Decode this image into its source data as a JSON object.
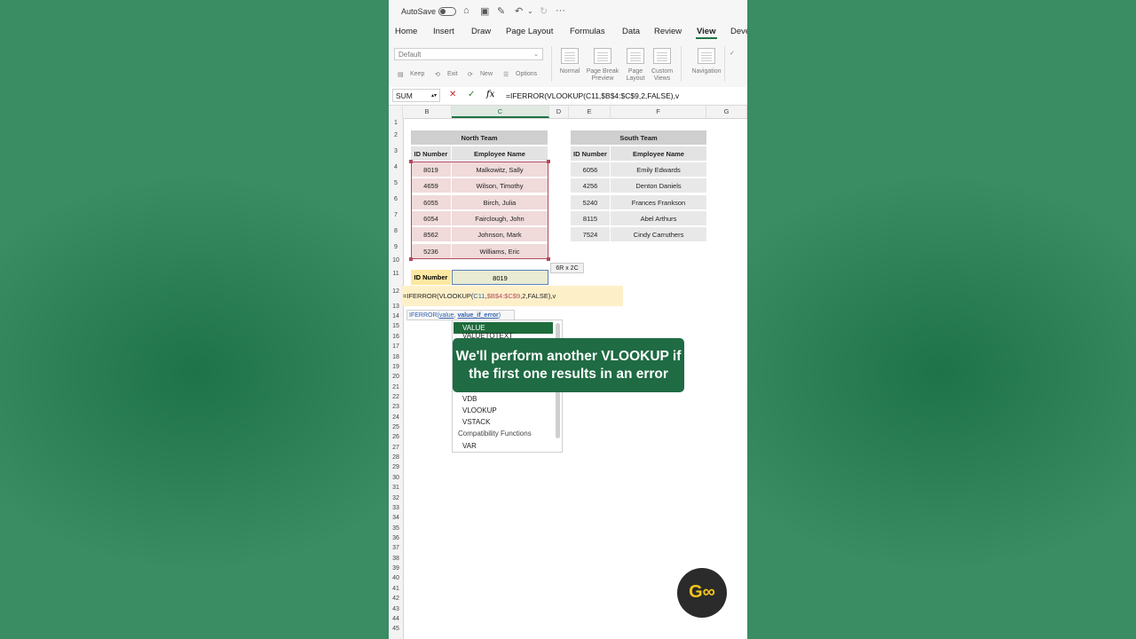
{
  "titlebar": {
    "autosave": "AutoSave",
    "more": "···"
  },
  "tabs": [
    "Home",
    "Insert",
    "Draw",
    "Page Layout",
    "Formulas",
    "Data",
    "Review",
    "View",
    "Deve"
  ],
  "ribbon": {
    "style_select": "Default",
    "keep": "Keep",
    "exit": "Exit",
    "new": "New",
    "options": "Options",
    "normal": "Normal",
    "page_break_preview": "Page Break\nPreview",
    "page_layout": "Page\nLayout",
    "custom_views": "Custom\nViews",
    "navigation": "Navigation"
  },
  "formula_bar": {
    "name_box": "SUM",
    "cancel": "✕",
    "enter": "✓",
    "fx": "fx",
    "formula": "=IFERROR(VLOOKUP(C11,$B$4:$C$9,2,FALSE),v"
  },
  "columns": [
    "B",
    "C",
    "D",
    "E",
    "F",
    "G"
  ],
  "rows": [
    "1",
    "2",
    "3",
    "4",
    "5",
    "6",
    "7",
    "8",
    "9",
    "10",
    "11",
    "12",
    "13",
    "14",
    "15",
    "16",
    "17",
    "18",
    "19",
    "20",
    "21",
    "22",
    "23",
    "24",
    "25",
    "26",
    "27",
    "28",
    "29",
    "30",
    "31",
    "32",
    "33",
    "34",
    "35",
    "36",
    "37",
    "38",
    "39",
    "40",
    "41",
    "42",
    "43",
    "44",
    "45"
  ],
  "north": {
    "title": "North Team",
    "headers": [
      "ID Number",
      "Employee Name"
    ],
    "rows": [
      [
        "8019",
        "Malkowitz, Sally"
      ],
      [
        "4659",
        "Wilson, Timothy"
      ],
      [
        "6055",
        "Birch, Julia"
      ],
      [
        "6054",
        "Fairclough, John"
      ],
      [
        "8562",
        "Johnson, Mark"
      ],
      [
        "5236",
        "Williams, Eric"
      ]
    ]
  },
  "south": {
    "title": "South Team",
    "headers": [
      "ID Number",
      "Employee Name"
    ],
    "rows": [
      [
        "6056",
        "Emily Edwards"
      ],
      [
        "4256",
        "Denton Daniels"
      ],
      [
        "5240",
        "Frances Frankson"
      ],
      [
        "8115",
        "Abel Arthurs"
      ],
      [
        "7524",
        "Cindy Carruthers"
      ]
    ]
  },
  "range_size": "6R x 2C",
  "lookup": {
    "label": "ID Number",
    "value": "8019"
  },
  "edit_cell": {
    "prefix": "=IFERROR(VLOOKUP(",
    "ref1": "C11",
    "comma": ",",
    "ref2": "$B$4:$C$9",
    "suffix": ",2,FALSE),v"
  },
  "arg_tip": {
    "fn": "IFERROR(",
    "arg1": "value",
    "sep": ", ",
    "arg2": "value_if_error",
    "close": ")"
  },
  "autocomplete": [
    "VALUE",
    "VALUETOTEXT",
    "VDB",
    "VLOOKUP",
    "VSTACK",
    "Compatibility Functions",
    "VAR"
  ],
  "banner": "We'll perform another VLOOKUP if the first one results in an error",
  "logo": "G∞"
}
